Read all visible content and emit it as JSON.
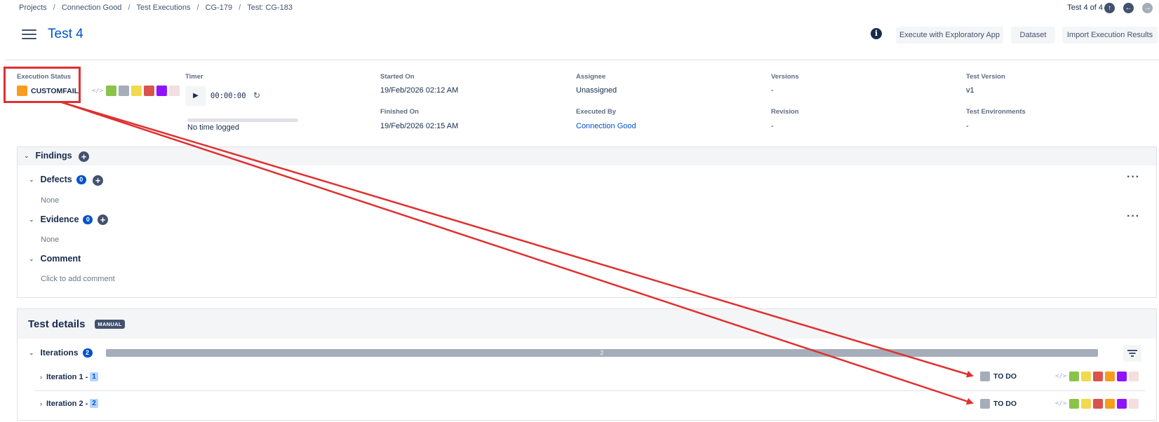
{
  "breadcrumb": [
    "Projects",
    "Connection Good",
    "Test Executions",
    "CG-179",
    "Test: CG-183"
  ],
  "pager": "Test 4 of 4",
  "header": {
    "title": "Test 4",
    "buttons": {
      "exploratory": "Execute with Exploratory App",
      "dataset": "Dataset",
      "import": "Import Execution Results"
    }
  },
  "execution": {
    "status_label": "Execution Status",
    "status_value": "CUSTOMFAIL",
    "status_color": "#f79c1e",
    "swatch_colors": [
      "#8bc34a",
      "#a5adba",
      "#f2d94e",
      "#d9534f",
      "#9013fe",
      "#f4dede"
    ],
    "timer_label": "Timer",
    "timer_value": "00:00:00",
    "time_logged": "No time logged",
    "time_logged_fraction": 0,
    "started_label": "Started On",
    "started_value": "19/Feb/2026 02:12 AM",
    "finished_label": "Finished On",
    "finished_value": "19/Feb/2026 02:15 AM",
    "assignee_label": "Assignee",
    "assignee_value": "Unassigned",
    "executed_by_label": "Executed By",
    "executed_by_value": "Connection Good",
    "versions_label": "Versions",
    "versions_value": "-",
    "revision_label": "Revision",
    "revision_value": "-",
    "test_version_label": "Test Version",
    "test_version_value": "v1",
    "test_env_label": "Test Environments",
    "test_env_value": "-"
  },
  "findings": {
    "title": "Findings",
    "defects": {
      "title": "Defects",
      "count": "0",
      "empty": "None"
    },
    "evidence": {
      "title": "Evidence",
      "count": "0",
      "empty": "None"
    },
    "comment": {
      "title": "Comment",
      "placeholder": "Click to add comment"
    }
  },
  "test_details": {
    "title": "Test details",
    "badge": "MANUAL",
    "iterations": {
      "title": "Iterations",
      "count": "2",
      "bar_label": "2",
      "rows": [
        {
          "label": "Iteration 1 -",
          "num": "1",
          "status": "TO DO",
          "status_color": "#a5adba"
        },
        {
          "label": "Iteration 2 -",
          "num": "2",
          "status": "TO DO",
          "status_color": "#a5adba"
        }
      ],
      "swatch_colors": [
        "#8bc34a",
        "#f2d94e",
        "#d9534f",
        "#f79c1e",
        "#9013fe",
        "#f4dede"
      ]
    }
  },
  "annotation_color": "#e03030",
  "icons": {
    "menu": "hamburger-icon",
    "info": "info-icon",
    "nav": [
      "arrow-up-icon",
      "arrow-left-icon",
      "arrow-right-icon"
    ],
    "play": "play-icon",
    "reset": "reset-icon",
    "add": "plus-icon",
    "more": "more-icon",
    "filter": "filter-icon",
    "code": "code-icon"
  }
}
